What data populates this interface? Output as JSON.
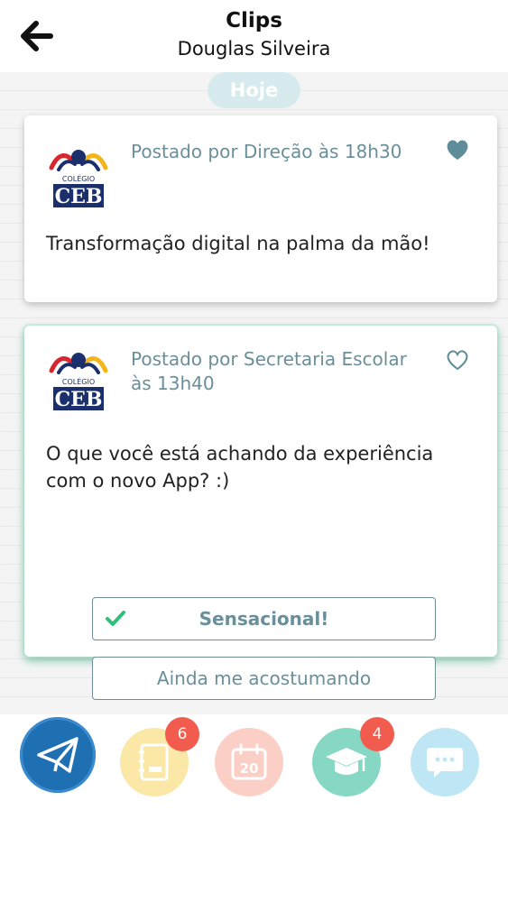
{
  "header": {
    "title": "Clips",
    "subtitle": "Douglas Silveira"
  },
  "feed": {
    "day_label": "Hoje",
    "posts": [
      {
        "poster": "Postado por Direção às 18h30",
        "liked": true,
        "message": "Transformação digital na palma da mão!",
        "logo_text": "CEB",
        "logo_top_text": "COLÉGIO"
      },
      {
        "poster": "Postado por Secretaria Escolar às 13h40",
        "liked": false,
        "message": "O que você está achando da experiência com o novo App? :)",
        "logo_text": "CEB",
        "logo_top_text": "COLÉGIO",
        "poll_options": [
          {
            "label": "Sensacional!",
            "selected": true
          },
          {
            "label": "Ainda me acostumando",
            "selected": false
          }
        ]
      }
    ]
  },
  "bottom_nav": {
    "items": [
      {
        "icon": "paper-plane-icon",
        "color": "#1f6fb3"
      },
      {
        "icon": "agenda-icon",
        "color": "#fbe7a6",
        "badge": "6"
      },
      {
        "icon": "calendar-icon",
        "color": "#fbcfc6",
        "calendar_day": "20"
      },
      {
        "icon": "graduation-cap-icon",
        "color": "#86d8c4",
        "badge": "4"
      },
      {
        "icon": "chat-bubble-icon",
        "color": "#bfe6f5"
      }
    ]
  },
  "colors": {
    "accent_text": "#6a8f9a",
    "heart": "#5e8c99",
    "check": "#2ec07a",
    "badge": "#f15c4f",
    "card_highlight": "#5ad6a0"
  }
}
